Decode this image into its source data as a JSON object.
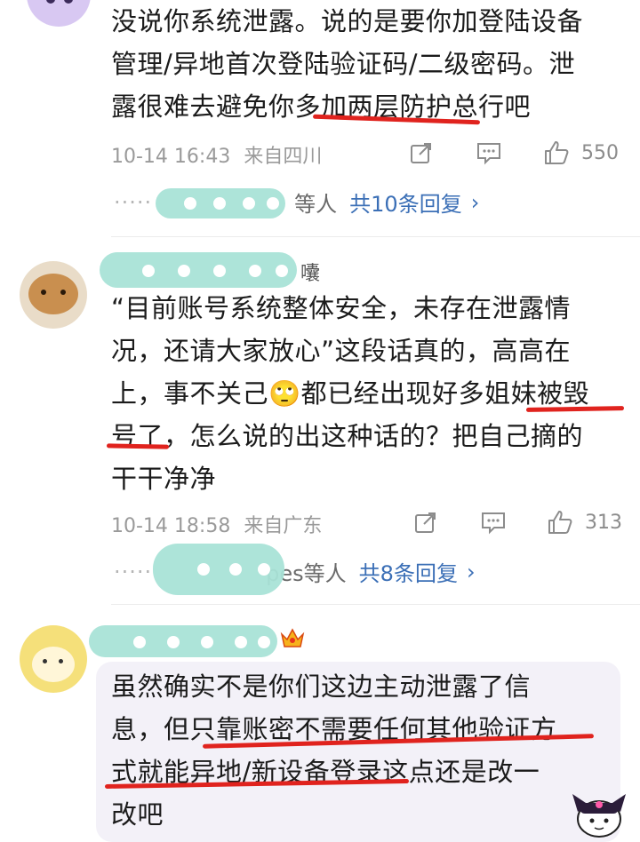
{
  "comments": [
    {
      "text_lines": [
        "没说你系统泄露。说的是要你加登陆设备",
        "管理/异地首次登陆验证码/二级密码。泄",
        "露很难去避免你多加两层防护总行吧"
      ],
      "time": "10-14 16:43",
      "location": "来自四川",
      "likes": "550",
      "reply_tail": "等人",
      "reply_link": "共10条回复",
      "reply_chevron": "›"
    },
    {
      "name_tail": "囔",
      "text_lines": [
        "“目前账号系统整体安全，未存在泄露情",
        "况，还请大家放心”这段话真的，高高在",
        "上，事不关己🙄都已经出现好多姐妹被毁",
        "号了，怎么说的出这种话的？把自己摘的",
        "干干净净"
      ],
      "time": "10-14 18:58",
      "location": "来自广东",
      "likes": "313",
      "reply_partial": "pes等人",
      "reply_link": "共8条回复",
      "reply_chevron": "›"
    },
    {
      "text_lines": [
        "虽然确实不是你们这边主动泄露了信",
        "息，但只靠账密不需要任何其他验证方",
        "式就能异地/新设备登录这点还是改一",
        "改吧"
      ],
      "badge_icon": "crown-badge-icon"
    }
  ],
  "icons": {
    "share": "share-icon",
    "comment": "comment-icon",
    "like": "thumbs-up-icon"
  },
  "colors": {
    "link": "#3b6fb6",
    "underline": "#e0231e",
    "blur": "#a9e3d7",
    "meta": "#9a9a9a",
    "bubble": "#f3f1f8"
  }
}
